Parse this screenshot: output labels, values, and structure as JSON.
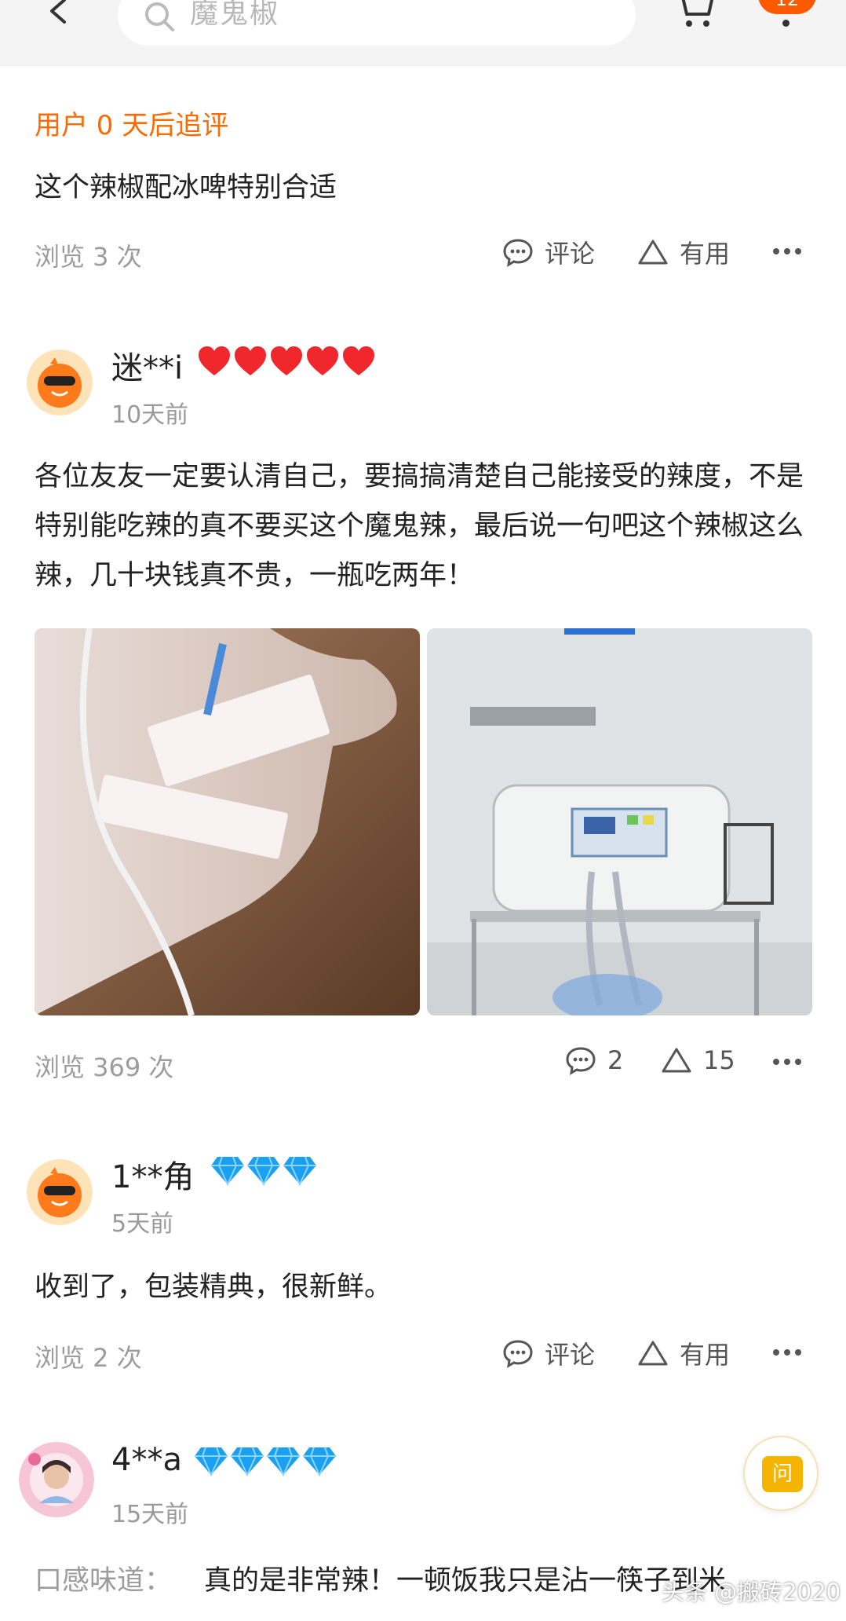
{
  "header": {
    "search_placeholder": "魔鬼椒",
    "cart_badge": "12"
  },
  "reviews": [
    {
      "followup_label": "用户 0 天后追评",
      "text": "这个辣椒配冰啤特别合适",
      "views": "浏览 3 次",
      "comment_label": "评论",
      "useful_label": "有用"
    },
    {
      "username": "迷**i",
      "level_badge": "heart",
      "level_count": 5,
      "time": "10天前",
      "text": "各位友友一定要认清自己，要搞搞清楚自己能接受的辣度，不是特别能吃辣的真不要买这个魔鬼辣，最后说一句吧这个辣椒这么辣，几十块钱真不贵，一瓶吃两年！",
      "views": "浏览 369 次",
      "comment_count": "2",
      "useful_count": "15",
      "photos": [
        "hand-iv-drip-photo",
        "gastric-lavage-machine-photo"
      ]
    },
    {
      "username": "1**角",
      "level_badge": "diamond",
      "level_count": 3,
      "time": "5天前",
      "text": "收到了，包装精典，很新鲜。",
      "views": "浏览 2 次",
      "comment_label": "评论",
      "useful_label": "有用"
    },
    {
      "username": "4**a",
      "level_badge": "diamond",
      "level_count": 4,
      "time": "15天前",
      "taste_label": "口感味道：",
      "taste_text": "真的是非常辣！一顿饭我只是沾一筷子到米"
    }
  ],
  "fab": {
    "label": "问"
  },
  "watermark": "头条 @搬砖2020",
  "colors": {
    "accent": "#ff6a00",
    "badge": "#ff5a00",
    "heart": "#f0282d",
    "diamond": "#1aa0f0",
    "muted": "#9c9c9c"
  }
}
